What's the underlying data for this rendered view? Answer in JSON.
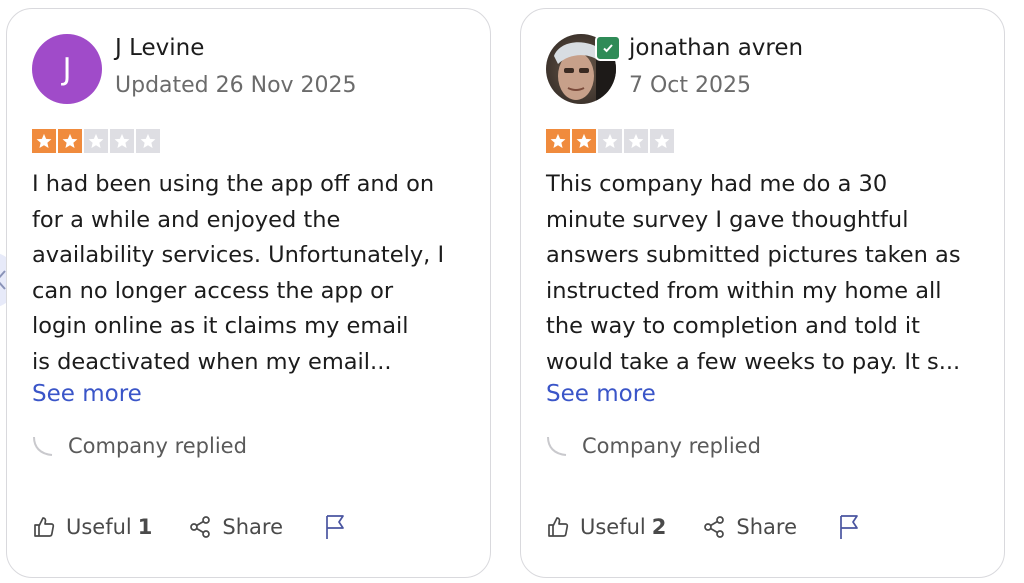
{
  "reviews": [
    {
      "avatar_letter": "J",
      "author": "J Levine",
      "date": "Updated 26 Nov 2025",
      "rating": 2,
      "text_lines": [
        "I had been using the app off and on",
        "for a while and enjoyed the",
        "availability services. Unfortunately, I",
        "can no longer access the app or",
        "login online as it claims my email",
        "is deactivated when my email..."
      ],
      "see_more": "See more",
      "company_replied": "Company replied",
      "useful_label": "Useful",
      "useful_count": "1",
      "share_label": "Share"
    },
    {
      "author": "jonathan avren",
      "date": "7 Oct 2025",
      "rating": 2,
      "text_lines": [
        "This company had me do a 30",
        "minute survey I gave thoughtful",
        "answers submitted pictures taken as",
        "instructed from within my home all",
        "the way to completion and told it",
        "would take a few weeks to pay. It s..."
      ],
      "see_more": "See more",
      "company_replied": "Company replied",
      "useful_label": "Useful",
      "useful_count": "2",
      "share_label": "Share"
    }
  ],
  "colors": {
    "star_filled": "#f08b3d",
    "star_empty": "#dedee3",
    "link": "#3a55c8",
    "avatar_purple": "#a04bc9",
    "verified_green": "#2f8b57"
  },
  "icons": [
    "thumbs-up-icon",
    "share-icon",
    "flag-icon",
    "reply-icon",
    "star-icon",
    "verified-icon",
    "chevron-left-icon"
  ]
}
